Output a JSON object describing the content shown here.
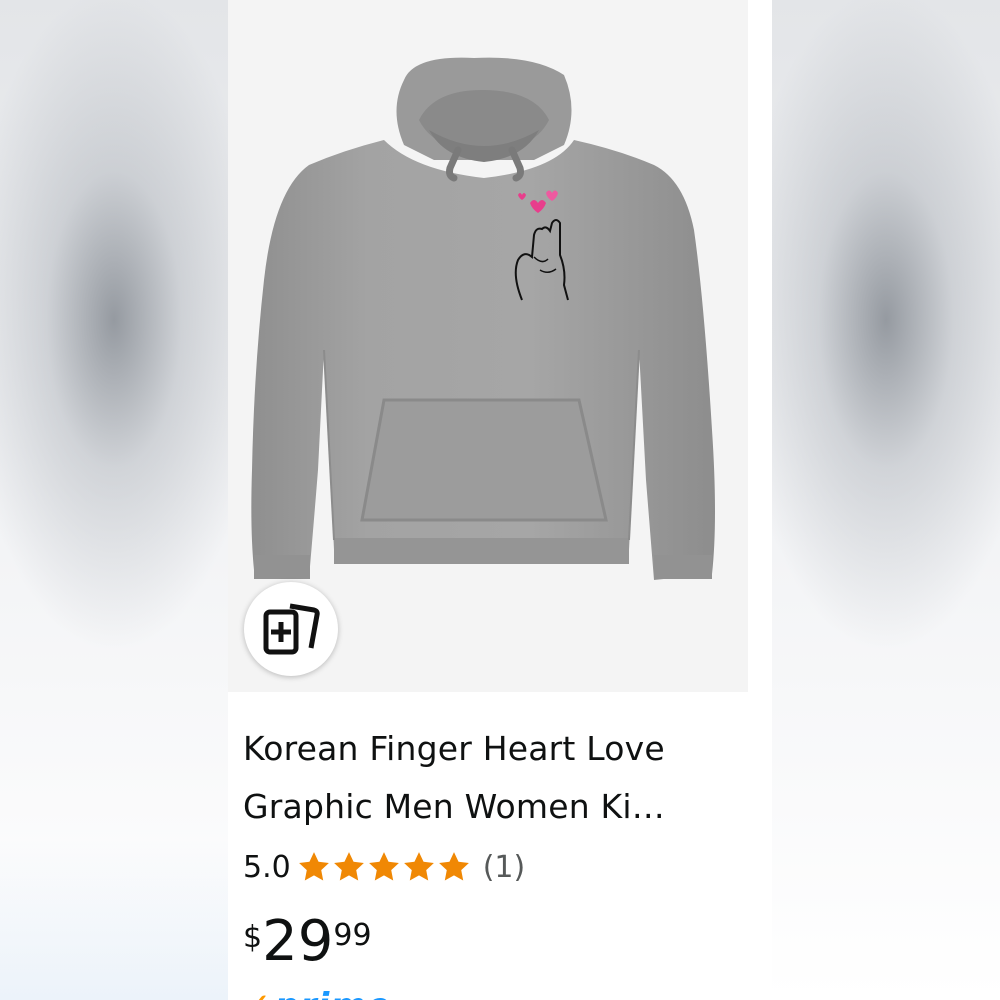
{
  "product": {
    "title_lines": [
      "Korean Finger Heart Love",
      "Graphic Men Women Ki…"
    ],
    "rating_value": "5.0",
    "rating_stars": 5,
    "review_count": "(1)",
    "price_symbol": "$",
    "price_whole": "29",
    "price_fraction": "99",
    "prime_label": "prime",
    "hoodie_color": "#9c9c9c",
    "heart_color": "#e83e8c",
    "star_color": "#f08804"
  },
  "icons": {
    "compare": "add-to-compare-icon",
    "star": "star-icon",
    "prime_check": "prime-check-icon"
  }
}
